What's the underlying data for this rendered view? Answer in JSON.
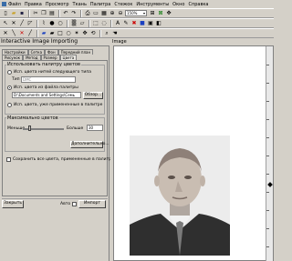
{
  "menu": [
    "Файл",
    "Правка",
    "Просмотр",
    "Ткань",
    "Палитра",
    "Стежок",
    "Инструменты",
    "Окно",
    "Справка"
  ],
  "toolbar": {
    "zoom_value": "150%"
  },
  "dialog": {
    "title": "Interactive Image Importing",
    "tabs_row1": [
      "Настройки",
      "Сетка",
      "Фон",
      "Передний план"
    ],
    "tabs_row2": [
      "Рисунок",
      "Метод",
      "Размер",
      "Цвета"
    ],
    "palette_group_label": "Использовать палитру цветов",
    "radio_type_colors": "Исп. цвета нитей следующего типа",
    "type_label": "Тип",
    "type_value": "DMC",
    "radio_palette_file": "Исп. цвета из файла палитры",
    "palette_path": "D:\\Documents and Settings\\Семь",
    "browse_label": "Обзор...",
    "radio_used_colors": "Исп. цвета, уже примененные в палитре",
    "max_colors_label": "Максимально цветов",
    "less_label": "Меньше",
    "more_label": "Больше",
    "max_colors_value": "30",
    "advanced_label": "Дополнительно...",
    "save_colors_label": "Сохранить все цвета, примененные в палитре",
    "close_label": "Закрыть",
    "auto_label": "Авто",
    "import_label": "Импорт"
  },
  "image_window": {
    "title": "Image"
  }
}
